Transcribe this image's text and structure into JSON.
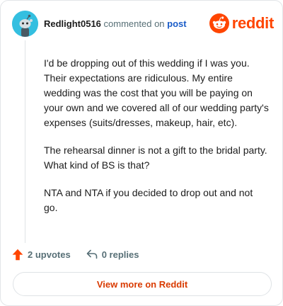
{
  "header": {
    "username": "Redlight0516",
    "action_text": "commented on",
    "post_link": "post",
    "brand": "reddit"
  },
  "comment": {
    "paragraphs": [
      "I'd be dropping out of this wedding if I was you. Their expectations are ridiculous. My entire wedding was the cost that you will be paying on your own and we covered all of our wedding party's expenses (suits/dresses, makeup, hair, etc).",
      "The rehearsal dinner is not a gift to the bridal party. What kind of BS is that?",
      "NTA and NTA if you decided to drop out and not go."
    ]
  },
  "footer": {
    "upvotes": "2 upvotes",
    "replies": "0 replies"
  },
  "cta": {
    "label": "View more on Reddit"
  },
  "colors": {
    "accent": "#ff4500",
    "link": "#1a5cc8",
    "cta_text": "#d93a00",
    "avatar_bg": "#34bfe0"
  },
  "icons": {
    "avatar": "snoo-avatar-icon",
    "brand": "reddit-logo-icon",
    "upvote": "upvote-arrow-icon",
    "reply": "reply-arrow-icon"
  }
}
